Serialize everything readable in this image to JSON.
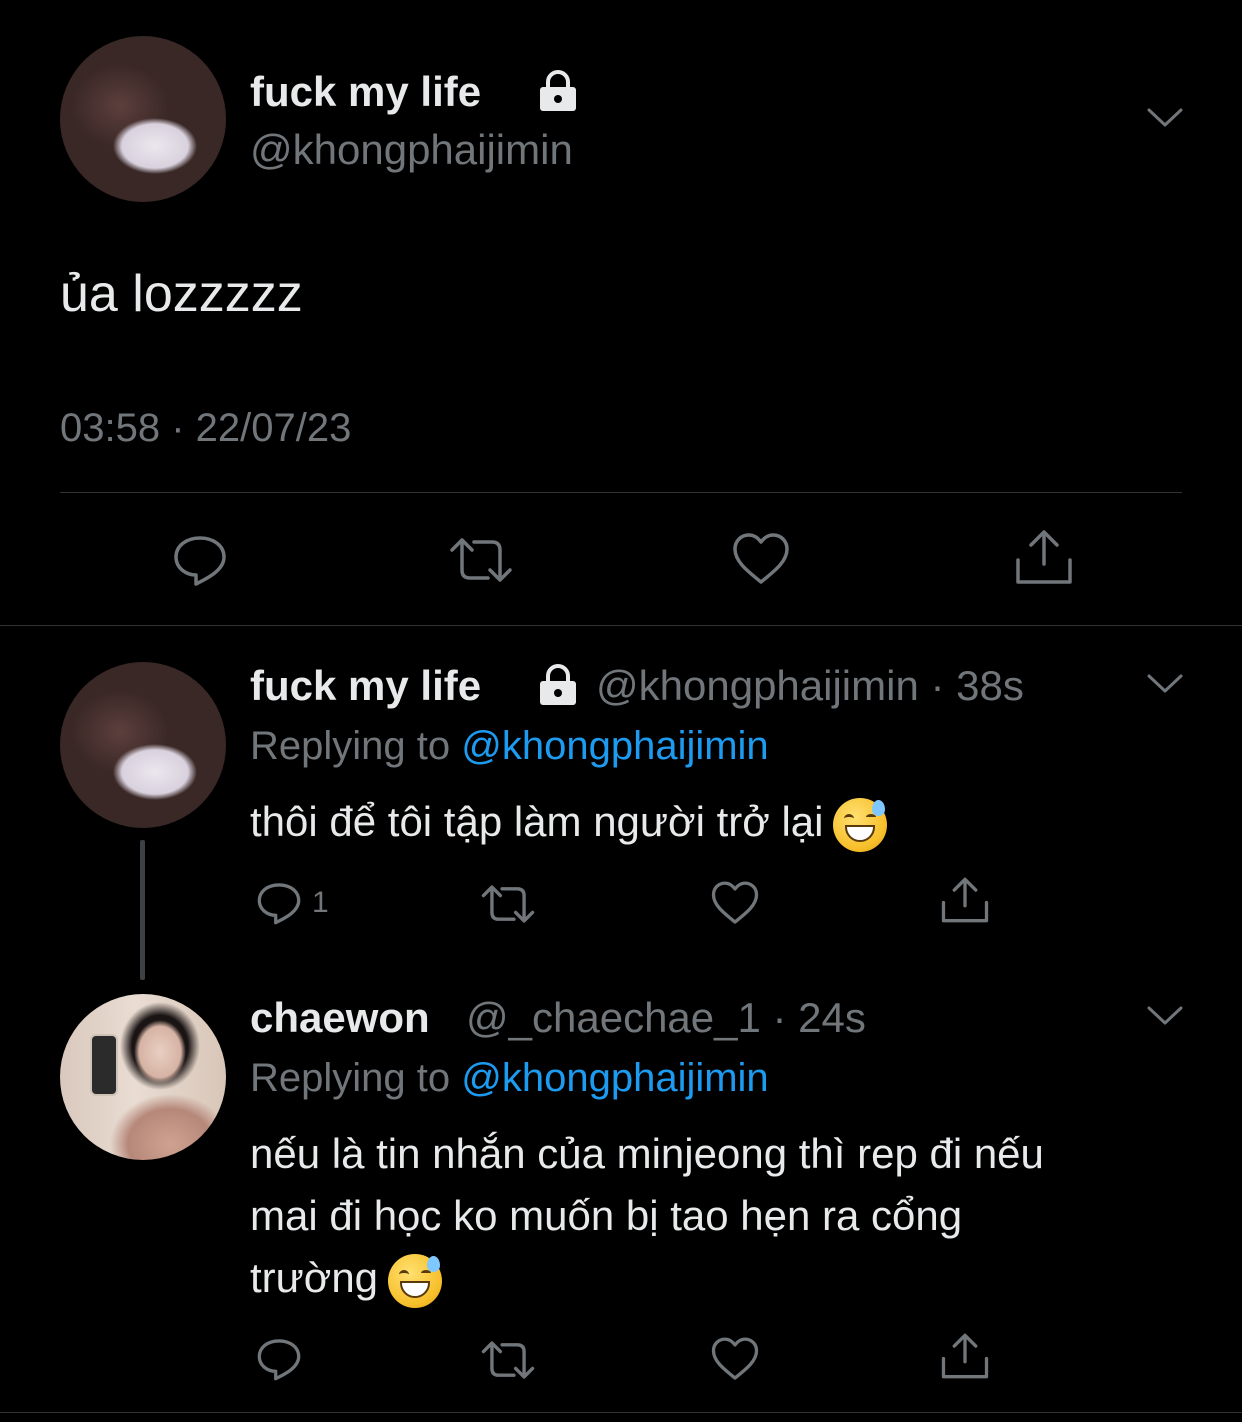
{
  "main_tweet": {
    "display_name": "fuck my life",
    "handle": "@khongphaijimin",
    "text": "ủa lozzzzz",
    "timestamp": "03:58 · 22/07/23"
  },
  "replies": [
    {
      "display_name": "fuck my life",
      "handle_and_time": "@khongphaijimin · 38s",
      "replying_prefix": "Replying to ",
      "replying_mention": "@khongphaijimin",
      "text": "thôi để tôi tập làm người trở lại",
      "reply_count": "1"
    },
    {
      "display_name": "chaewon",
      "handle_and_time": "@_chaechae_1 · 24s",
      "replying_prefix": "Replying to ",
      "replying_mention": "@khongphaijimin",
      "text_line1": "nếu là tin nhắn của minjeong thì rep đi nếu",
      "text_line2": "mai đi học ko muốn bị tao hẹn ra cổng",
      "text_line3": "trường",
      "reply_count": ""
    }
  ],
  "colors": {
    "background": "#000000",
    "text_primary": "#e7e9ea",
    "text_secondary": "#71767b",
    "accent": "#1d9bf0",
    "divider": "#2f3336"
  },
  "icons": [
    "lock-icon",
    "chevron-down-icon",
    "reply-icon",
    "retweet-icon",
    "like-icon",
    "share-icon",
    "grinning-sweat-emoji"
  ]
}
